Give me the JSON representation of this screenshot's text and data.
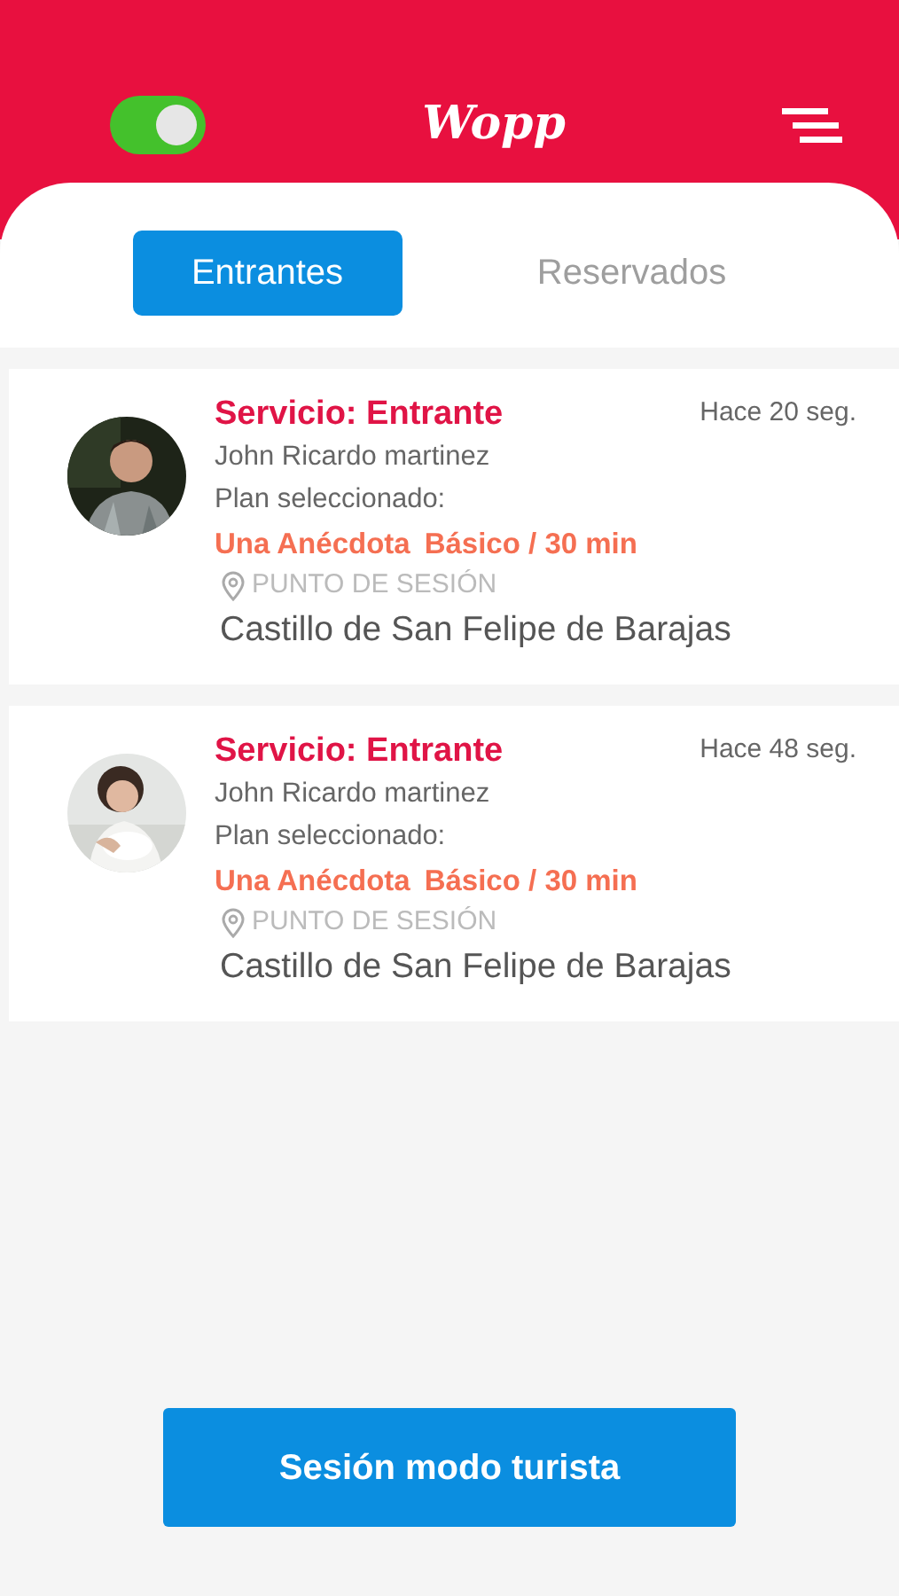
{
  "header": {
    "toggle": {
      "on": true
    },
    "logo": "Wopp"
  },
  "tabs": [
    {
      "label": "Entrantes",
      "selected": true
    },
    {
      "label": "Reservados",
      "selected": false
    }
  ],
  "services": [
    {
      "title": "Servicio: Entrante",
      "time": "Hace 20 seg.",
      "client": "John Ricardo martinez",
      "plan_label": "Plan seleccionado:",
      "plan": "Una Anécdota",
      "package": "Básico / 30 min",
      "point_label": "PUNTO DE SESIÓN",
      "place": "Castillo de San Felipe de Barajas"
    },
    {
      "title": "Servicio: Entrante",
      "time": "Hace 48 seg.",
      "client": "John Ricardo martinez",
      "plan_label": "Plan seleccionado:",
      "plan": "Una Anécdota",
      "package": "Básico / 30 min",
      "point_label": "PUNTO DE SESIÓN",
      "place": "Castillo de San Felipe de Barajas"
    }
  ],
  "primary_button": "Sesión modo turista"
}
